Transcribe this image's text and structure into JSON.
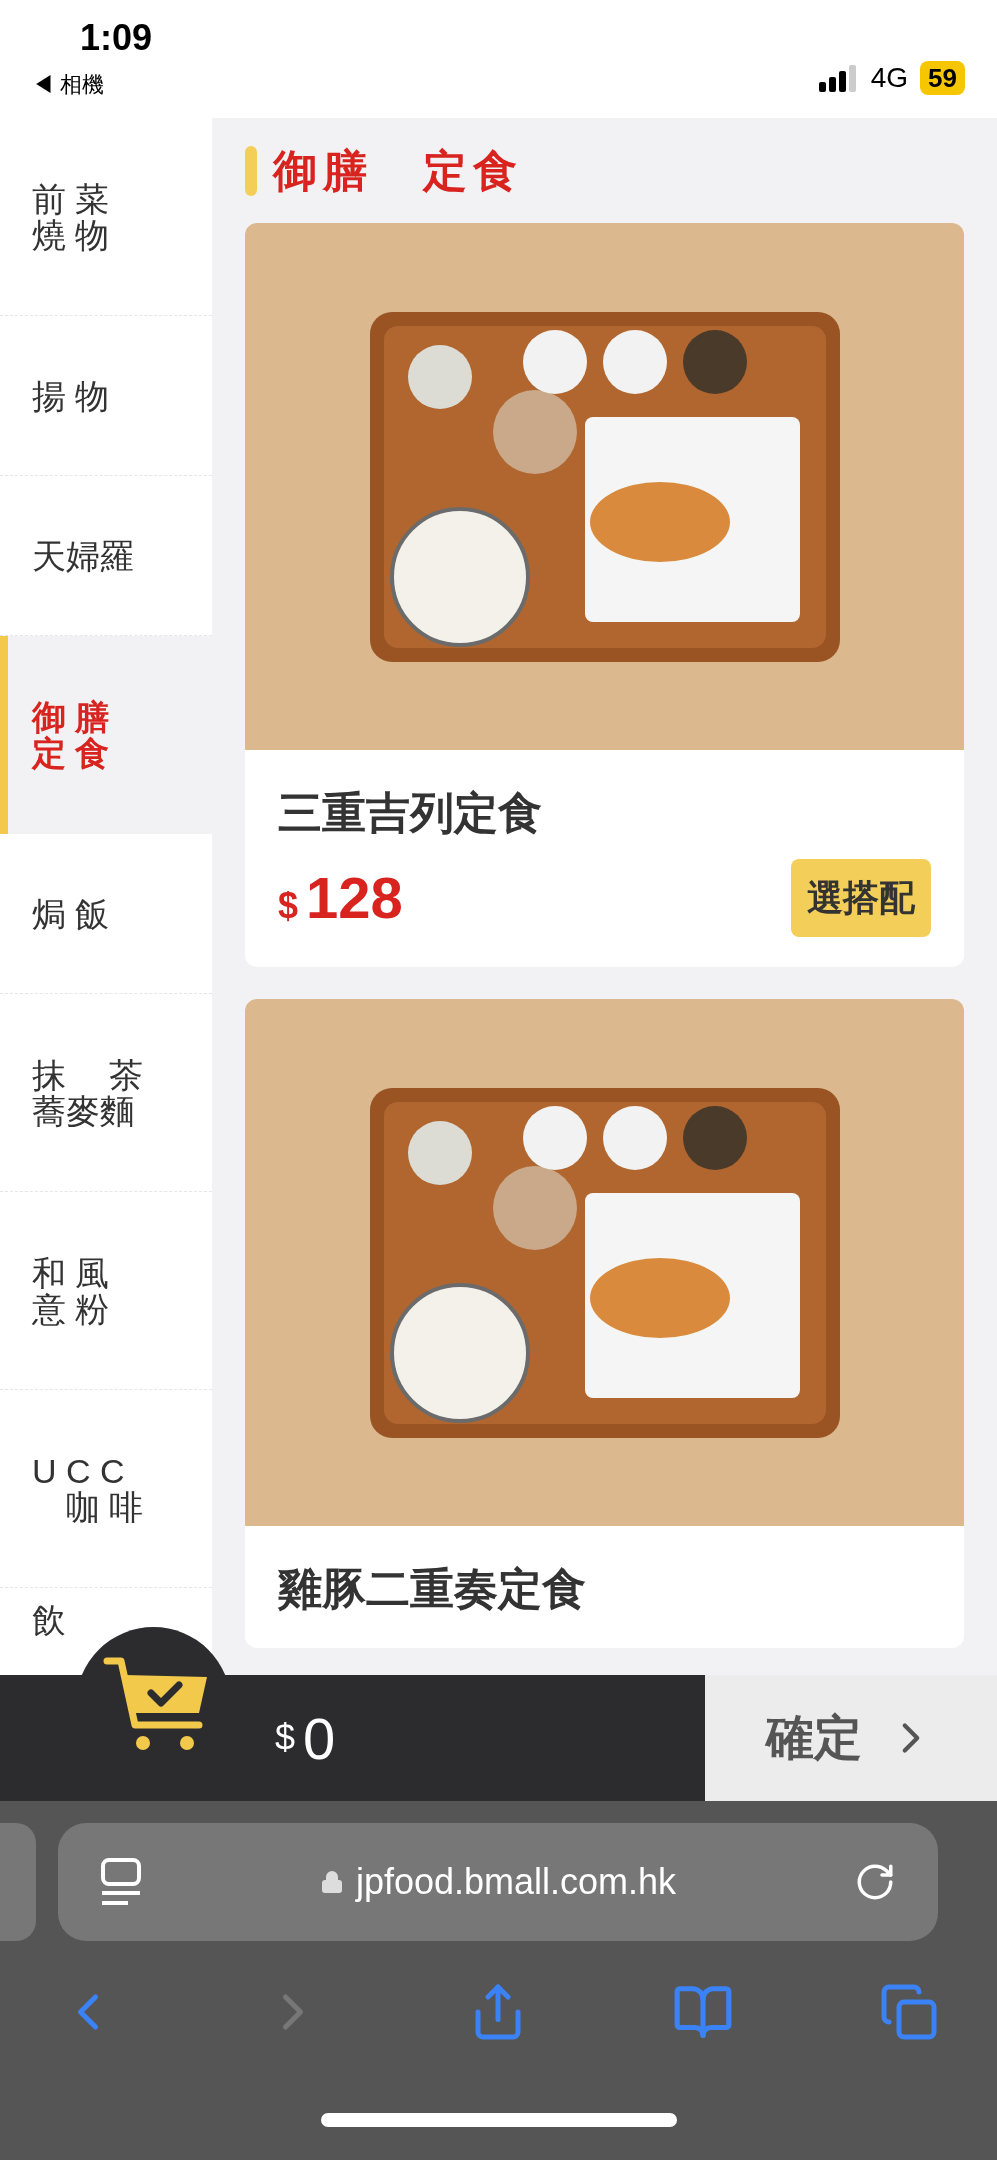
{
  "status_bar": {
    "time": "1:09",
    "back_app": "◀ 相機",
    "network": "4G",
    "battery": "59"
  },
  "sidebar": {
    "items": [
      {
        "lines": [
          "前 菜",
          "燒 物"
        ],
        "selected": false
      },
      {
        "lines": [
          "揚 物"
        ],
        "selected": false
      },
      {
        "lines": [
          "天婦羅"
        ],
        "selected": false
      },
      {
        "lines": [
          "御 膳",
          "定 食"
        ],
        "selected": true
      },
      {
        "lines": [
          "焗 飯"
        ],
        "selected": false
      },
      {
        "lines": [
          "抹　 茶",
          "蕎麥麵"
        ],
        "selected": false
      },
      {
        "lines": [
          "和 風",
          "意 粉"
        ],
        "selected": false
      },
      {
        "lines": [
          "U C C",
          "　咖 啡"
        ],
        "selected": false
      },
      {
        "lines": [
          "飲"
        ],
        "selected": false
      }
    ]
  },
  "section_title": "御膳　定食",
  "products": [
    {
      "name": "三重吉列定食",
      "currency": "$",
      "price": "128",
      "button": "選搭配"
    },
    {
      "name": "雞豚二重奏定食"
    }
  ],
  "cart_bar": {
    "currency": "$",
    "total": "0",
    "confirm": "確定"
  },
  "browser": {
    "url": "jpfood.bmall.com.hk"
  }
}
